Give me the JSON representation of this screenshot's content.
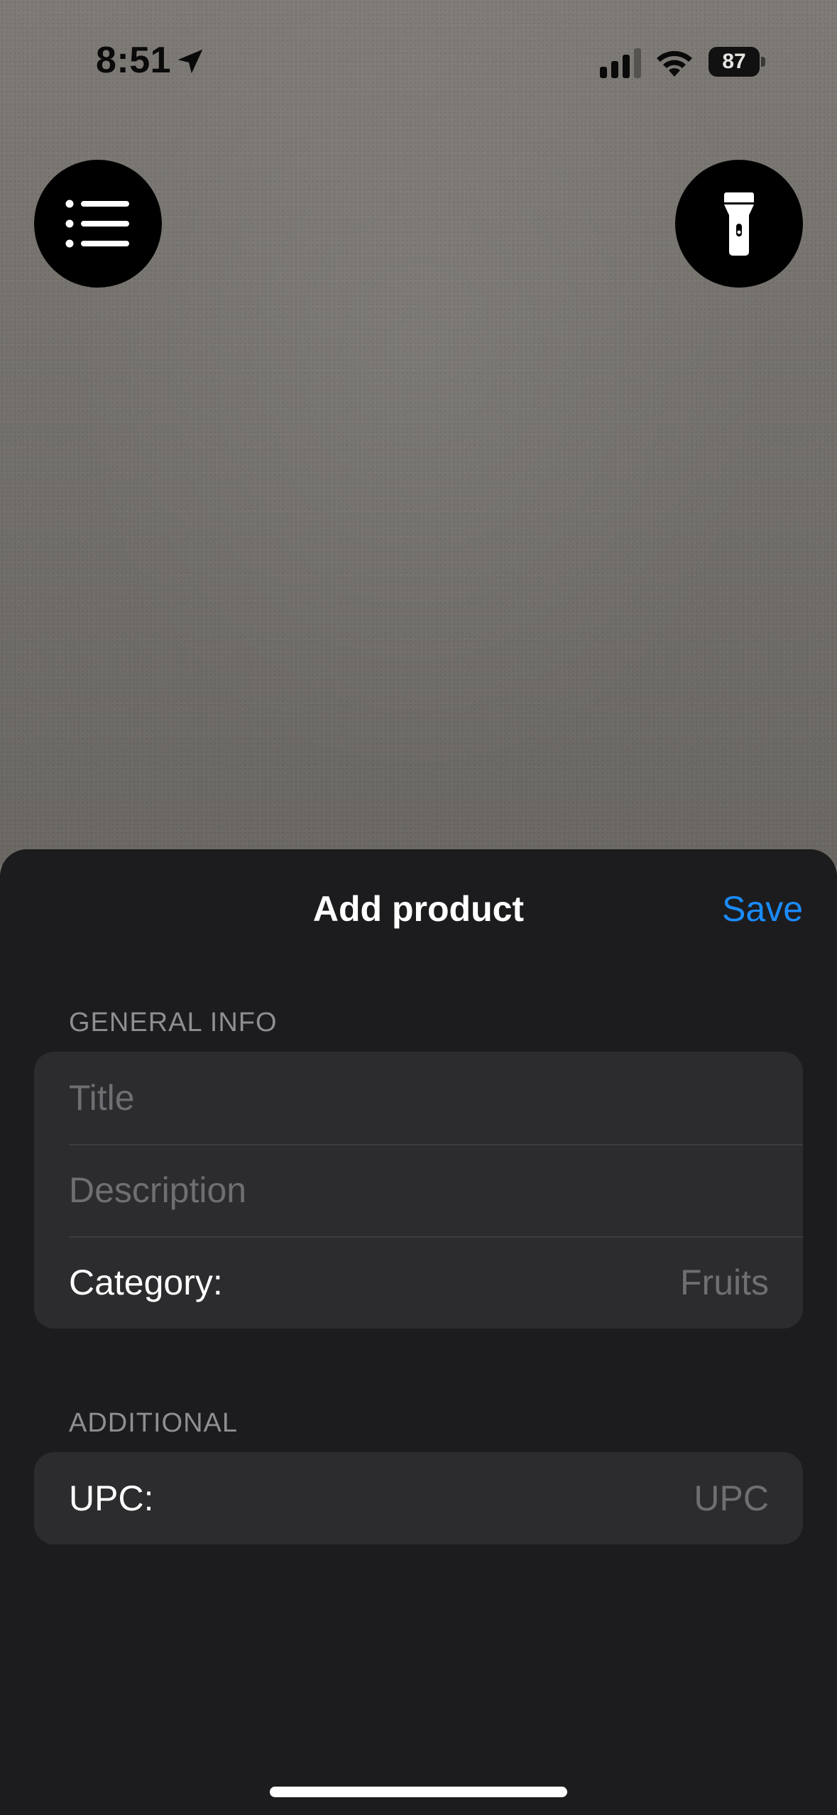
{
  "status_bar": {
    "time": "8:51",
    "battery": "87",
    "icons": [
      "location-arrow-icon",
      "cellular-signal-icon",
      "wifi-icon",
      "battery-icon"
    ]
  },
  "camera": {
    "list_button_icon": "list-icon",
    "flashlight_button_icon": "flashlight-icon"
  },
  "sheet": {
    "title": "Add product",
    "save_label": "Save",
    "general_info": {
      "header": "GENERAL INFO",
      "title_placeholder": "Title",
      "title_value": "",
      "description_placeholder": "Description",
      "description_value": "",
      "category_label": "Category:",
      "category_value": "Fruits"
    },
    "additional": {
      "header": "ADDITIONAL",
      "upc_label": "UPC:",
      "upc_placeholder": "UPC",
      "upc_value": ""
    }
  },
  "colors": {
    "accent": "#1a8cff",
    "sheet_background": "#1c1c1e",
    "group_background": "#2c2c2e",
    "secondary_text": "#8e8e93",
    "placeholder_text": "#6e6e73"
  }
}
